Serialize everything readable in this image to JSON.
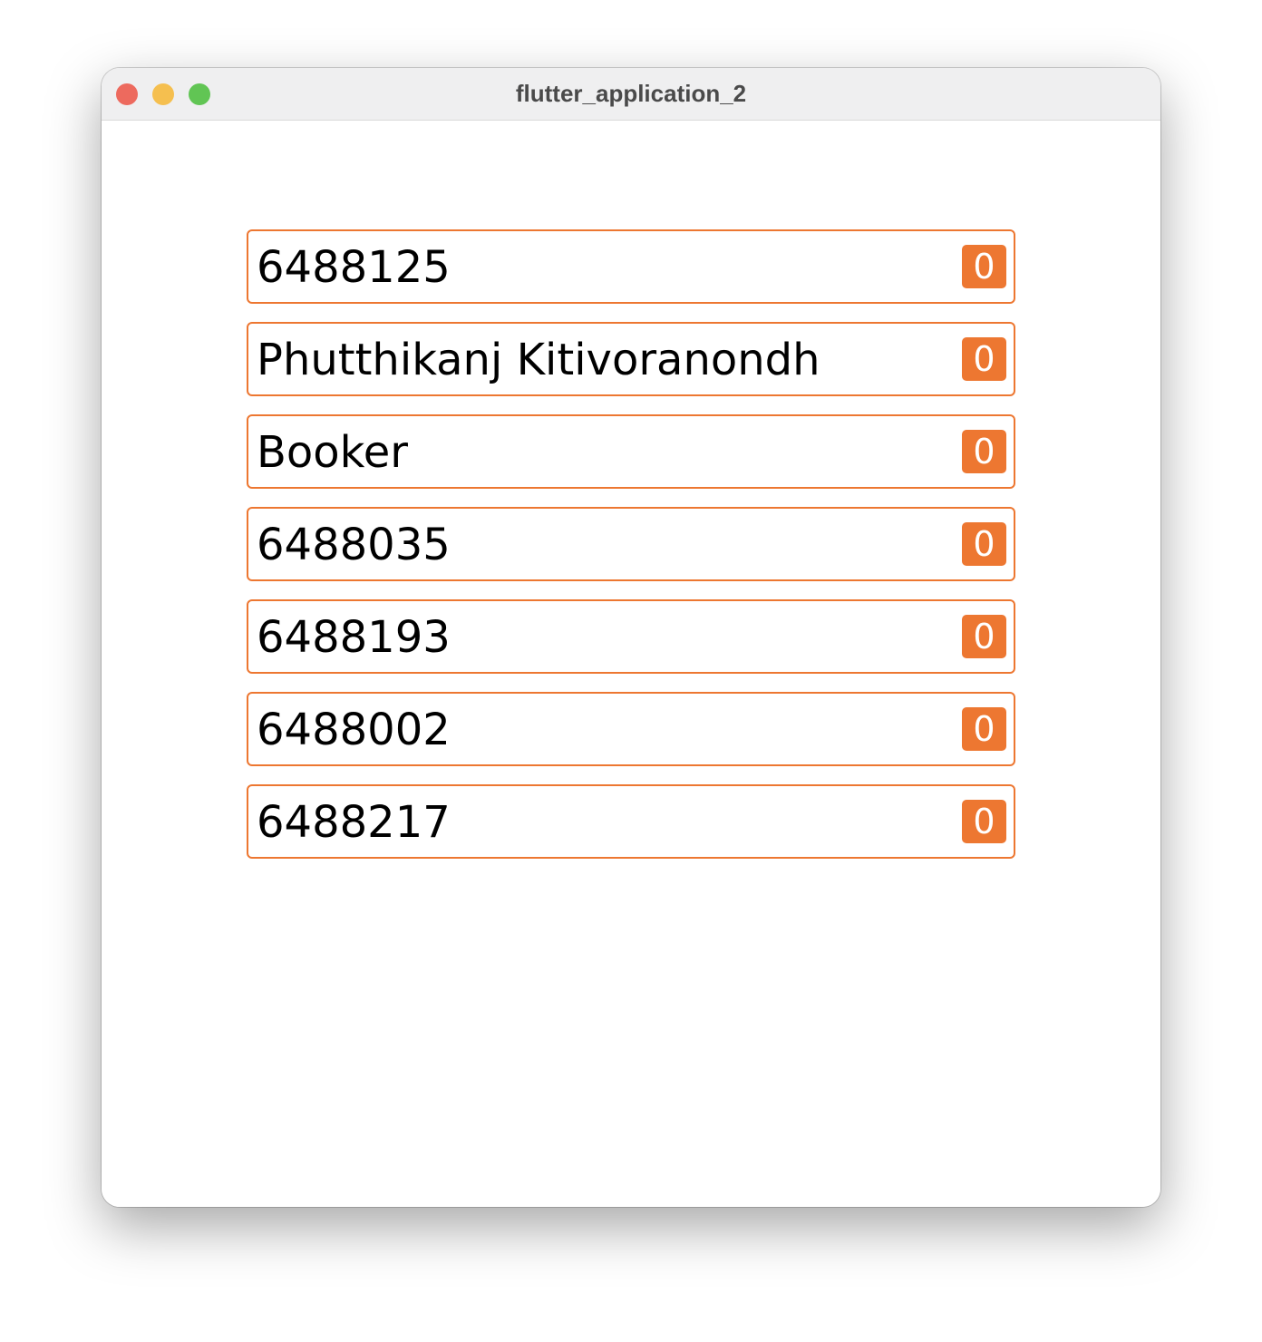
{
  "window": {
    "title": "flutter_application_2",
    "traffic_lights": {
      "close_color": "#ed6a5e",
      "minimize_color": "#f5bf4f",
      "zoom_color": "#61c554"
    }
  },
  "theme": {
    "accent": "#ed7731"
  },
  "items": [
    {
      "label": "6488125",
      "count": "0"
    },
    {
      "label": "Phutthikanj Kitivoranondh",
      "count": "0"
    },
    {
      "label": "Booker",
      "count": "0"
    },
    {
      "label": "6488035",
      "count": "0"
    },
    {
      "label": "6488193",
      "count": "0"
    },
    {
      "label": "6488002",
      "count": "0"
    },
    {
      "label": "6488217",
      "count": "0"
    }
  ]
}
